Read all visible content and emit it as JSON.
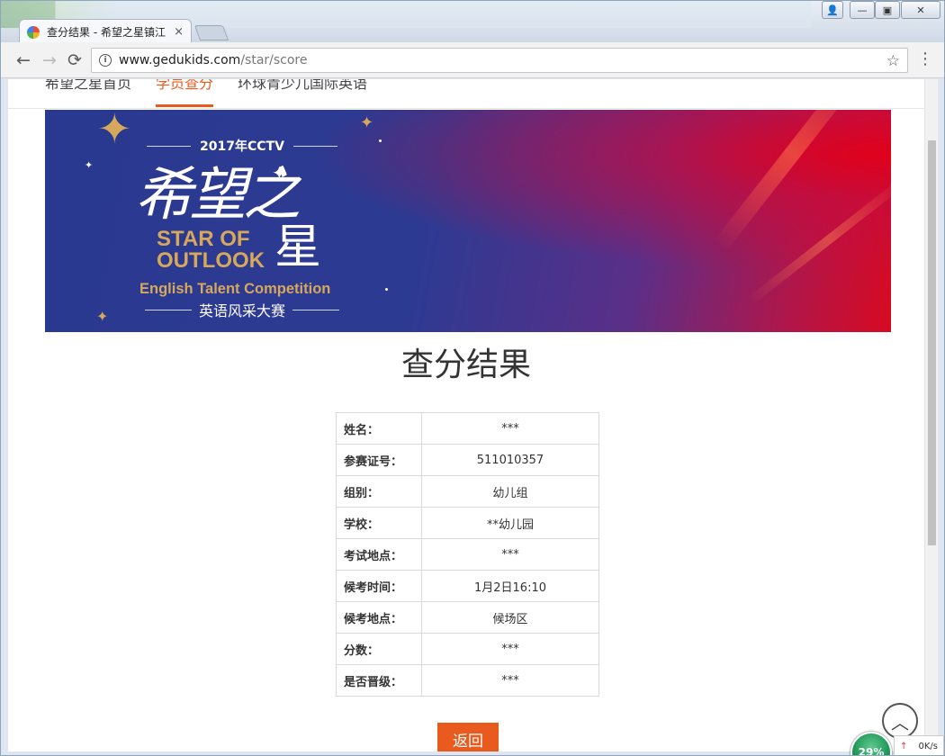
{
  "browser": {
    "tab_title": "查分结果 - 希望之星镇江",
    "tab_close": "×",
    "url_host": "www.gedukids.com",
    "url_path": "/star/score",
    "back": "←",
    "forward": "→",
    "reload": "⟳",
    "bookmark": "☆",
    "menu": "⋮",
    "window_user": "👤",
    "window_min": "—",
    "window_max": "▣",
    "window_close": "✕"
  },
  "site_nav": {
    "items": [
      {
        "label": "希望之星首页",
        "active": false
      },
      {
        "label": "学员查分",
        "active": true
      },
      {
        "label": "环球青少儿国际英语",
        "active": false
      }
    ]
  },
  "banner": {
    "tagline": "2017年CCTV",
    "logo_cn": "希望之",
    "logo_en_line1": "STAR OF",
    "logo_en_line2": "OUTLOOK",
    "logo_xing": "星",
    "subtitle_en": "English Talent Competition",
    "subtitle_cn": "英语风采大赛"
  },
  "page": {
    "title": "查分结果"
  },
  "result_table": {
    "rows": [
      {
        "label": "姓名：",
        "value": "***"
      },
      {
        "label": "参赛证号：",
        "value": "511010357"
      },
      {
        "label": "组别：",
        "value": "幼儿组"
      },
      {
        "label": "学校：",
        "value": "**幼儿园"
      },
      {
        "label": "考试地点：",
        "value": "***"
      },
      {
        "label": "候考时间：",
        "value": "1月2日16:10"
      },
      {
        "label": "候考地点：",
        "value": "候场区"
      },
      {
        "label": "分数：",
        "value": "***"
      },
      {
        "label": "是否晋级：",
        "value": "***"
      }
    ]
  },
  "actions": {
    "back_label": "返回",
    "to_top": "︿"
  },
  "speed_widget": {
    "percent": "29%",
    "upload_arrow": "↑",
    "rate": "0K/s"
  },
  "colors": {
    "accent": "#e85a1e",
    "banner_blue": "#2d3a92",
    "banner_red": "#d80a22",
    "gold": "#d6a85c"
  }
}
